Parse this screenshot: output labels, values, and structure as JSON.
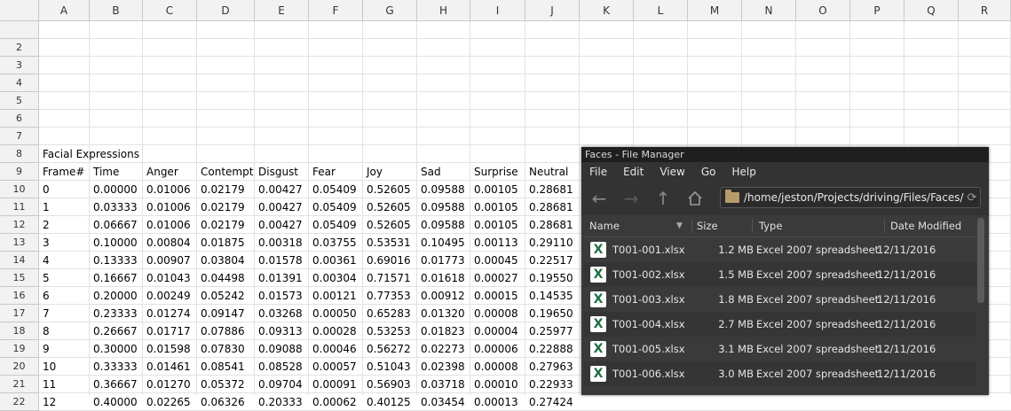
{
  "spreadsheet": {
    "columns": [
      "A",
      "B",
      "C",
      "D",
      "E",
      "F",
      "G",
      "H",
      "I",
      "J",
      "K",
      "L",
      "M",
      "N",
      "O",
      "P",
      "Q",
      "R"
    ],
    "rows": [
      "",
      "2",
      "3",
      "4",
      "5",
      "6",
      "7",
      "8",
      "9",
      "10",
      "11",
      "12",
      "13",
      "14",
      "15",
      "16",
      "17",
      "18",
      "19",
      "20",
      "21",
      "22"
    ],
    "title_cell": "Facial Expressions",
    "headers": [
      "Frame#",
      "Time",
      "Anger",
      "Contempt",
      "Disgust",
      "Fear",
      "Joy",
      "Sad",
      "Surprise",
      "Neutral"
    ],
    "data": [
      [
        "0",
        "0.00000",
        "0.01006",
        "0.02179",
        "0.00427",
        "0.05409",
        "0.52605",
        "0.09588",
        "0.00105",
        "0.28681"
      ],
      [
        "1",
        "0.03333",
        "0.01006",
        "0.02179",
        "0.00427",
        "0.05409",
        "0.52605",
        "0.09588",
        "0.00105",
        "0.28681"
      ],
      [
        "2",
        "0.06667",
        "0.01006",
        "0.02179",
        "0.00427",
        "0.05409",
        "0.52605",
        "0.09588",
        "0.00105",
        "0.28681"
      ],
      [
        "3",
        "0.10000",
        "0.00804",
        "0.01875",
        "0.00318",
        "0.03755",
        "0.53531",
        "0.10495",
        "0.00113",
        "0.29110"
      ],
      [
        "4",
        "0.13333",
        "0.00907",
        "0.03804",
        "0.01578",
        "0.00361",
        "0.69016",
        "0.01773",
        "0.00045",
        "0.22517"
      ],
      [
        "5",
        "0.16667",
        "0.01043",
        "0.04498",
        "0.01391",
        "0.00304",
        "0.71571",
        "0.01618",
        "0.00027",
        "0.19550"
      ],
      [
        "6",
        "0.20000",
        "0.00249",
        "0.05242",
        "0.01573",
        "0.00121",
        "0.77353",
        "0.00912",
        "0.00015",
        "0.14535"
      ],
      [
        "7",
        "0.23333",
        "0.01274",
        "0.09147",
        "0.03268",
        "0.00050",
        "0.65283",
        "0.01320",
        "0.00008",
        "0.19650"
      ],
      [
        "8",
        "0.26667",
        "0.01717",
        "0.07886",
        "0.09313",
        "0.00028",
        "0.53253",
        "0.01823",
        "0.00004",
        "0.25977"
      ],
      [
        "9",
        "0.30000",
        "0.01598",
        "0.07830",
        "0.09088",
        "0.00046",
        "0.56272",
        "0.02273",
        "0.00006",
        "0.22888"
      ],
      [
        "10",
        "0.33333",
        "0.01461",
        "0.08541",
        "0.08528",
        "0.00057",
        "0.51043",
        "0.02398",
        "0.00008",
        "0.27963"
      ],
      [
        "11",
        "0.36667",
        "0.01270",
        "0.05372",
        "0.09704",
        "0.00091",
        "0.56903",
        "0.03718",
        "0.00010",
        "0.22933"
      ],
      [
        "12",
        "0.40000",
        "0.02265",
        "0.06326",
        "0.20333",
        "0.00062",
        "0.40125",
        "0.03454",
        "0.00013",
        "0.27424"
      ]
    ]
  },
  "file_manager": {
    "title": "Faces - File Manager",
    "menu": [
      "File",
      "Edit",
      "View",
      "Go",
      "Help"
    ],
    "location": "/home/jeston/Projects/driving/Files/Faces/",
    "columns": {
      "name": "Name",
      "size": "Size",
      "type": "Type",
      "modified": "Date Modified"
    },
    "files": [
      {
        "name": "T001-001.xlsx",
        "size": "1.2 MB",
        "type": "Excel 2007 spreadsheet",
        "modified": "12/11/2016"
      },
      {
        "name": "T001-002.xlsx",
        "size": "1.5 MB",
        "type": "Excel 2007 spreadsheet",
        "modified": "12/11/2016"
      },
      {
        "name": "T001-003.xlsx",
        "size": "1.8 MB",
        "type": "Excel 2007 spreadsheet",
        "modified": "12/11/2016"
      },
      {
        "name": "T001-004.xlsx",
        "size": "2.7 MB",
        "type": "Excel 2007 spreadsheet",
        "modified": "12/11/2016"
      },
      {
        "name": "T001-005.xlsx",
        "size": "3.1 MB",
        "type": "Excel 2007 spreadsheet",
        "modified": "12/11/2016"
      },
      {
        "name": "T001-006.xlsx",
        "size": "3.0 MB",
        "type": "Excel 2007 spreadsheet",
        "modified": "12/11/2016"
      }
    ],
    "icons": {
      "back": "arrow-left-icon",
      "forward": "arrow-right-icon",
      "up": "arrow-up-icon",
      "home": "home-icon",
      "folder": "folder-icon",
      "reload": "reload-icon",
      "file": "excel-file-icon"
    }
  }
}
